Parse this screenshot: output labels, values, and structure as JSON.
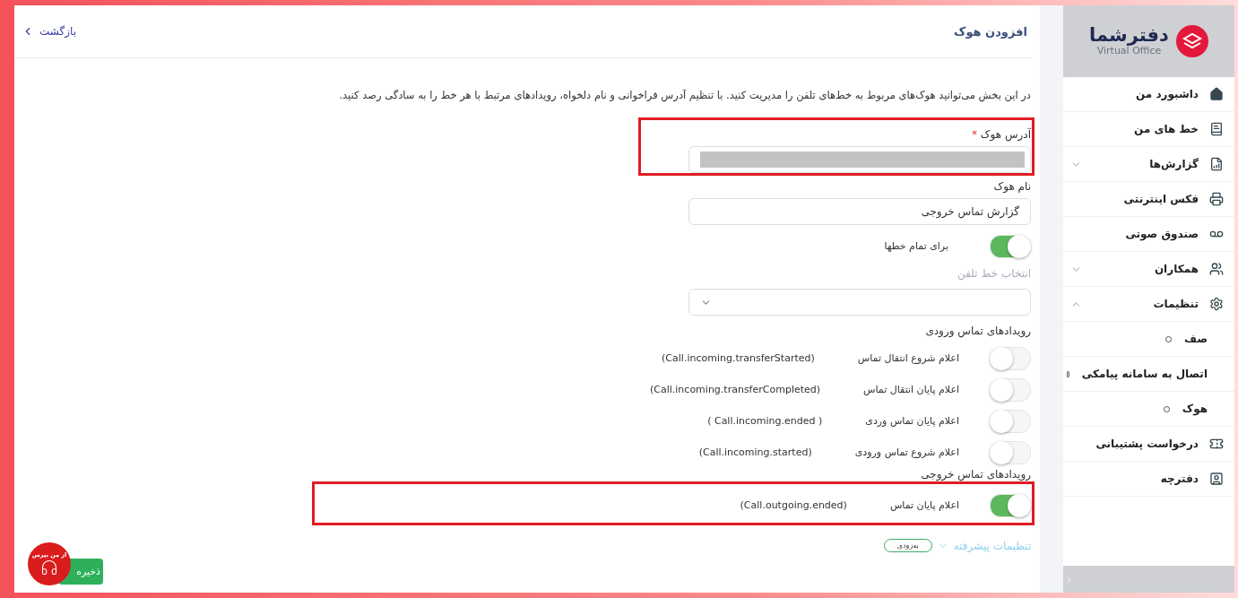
{
  "sidebar": {
    "logo": {
      "name": "دفترشما",
      "tagline": "Virtual Office"
    },
    "items": [
      {
        "label": "داشبورد من",
        "kind": "link"
      },
      {
        "label": "خط های من",
        "kind": "link"
      },
      {
        "label": "گزارش‌ها",
        "kind": "group",
        "expanded": false
      },
      {
        "label": "فکس اینترنتی",
        "kind": "link"
      },
      {
        "label": "صندوق صوتی",
        "kind": "link"
      },
      {
        "label": "همکاران",
        "kind": "group",
        "expanded": false
      },
      {
        "label": "تنظیمات",
        "kind": "group",
        "expanded": true,
        "children": [
          {
            "label": "صف"
          },
          {
            "label": "اتصال به سامانه پیامکی"
          },
          {
            "label": "هوک"
          }
        ]
      },
      {
        "label": "درخواست پشتیبانی",
        "kind": "link"
      },
      {
        "label": "دفترچه",
        "kind": "link"
      }
    ]
  },
  "header": {
    "title": "افزودن هوک",
    "back": "بازگشت"
  },
  "description": "در این بخش می‌توانید هوک‌های مربوط به خط‌های تلفن را مدیریت کنید. با تنظیم آدرس فراخوانی و نام دلخواه، رویدادهای مرتبط با هر خط را به سادگی رصد کنید.",
  "form": {
    "address": {
      "label": "آدرس هوک",
      "required_mark": "*",
      "highlighted": true,
      "redacted": true
    },
    "name": {
      "label": "نام هوک",
      "value": "گزارش تماس خروجی"
    },
    "all_lines": {
      "label": "برای تمام خطها",
      "on": true
    },
    "phone_line": {
      "label": "انتخاب خط تلفن",
      "disabled": true
    },
    "event_groups": [
      {
        "title": "رویدادهای تماس ورودی",
        "events": [
          {
            "label": "اعلام شروع انتقال تماس",
            "code": "(Call.incoming.transferStarted)",
            "on": false,
            "highlighted": false
          },
          {
            "label": "اعلام پایان انتقال تماس",
            "code": "(Call.incoming.transferCompleted)",
            "on": false,
            "highlighted": false
          },
          {
            "label": "اعلام پایان تماس وردی",
            "code": "( Call.incoming.ended )",
            "on": false,
            "highlighted": false
          },
          {
            "label": "اعلام شروع تماس ورودی",
            "code": "(Call.incoming.started)",
            "on": false,
            "highlighted": false
          }
        ]
      },
      {
        "title": "رویدادهای تماس خروجی",
        "events": [
          {
            "label": "اعلام پایان تماس",
            "code": "(Call.outgoing.ended)",
            "on": true,
            "highlighted": true
          }
        ]
      }
    ],
    "advanced": {
      "label": "تنظیمات پیشرفته",
      "badge": "به‌زودی"
    }
  },
  "save": "ذخیره",
  "help": "از من بپرس"
}
